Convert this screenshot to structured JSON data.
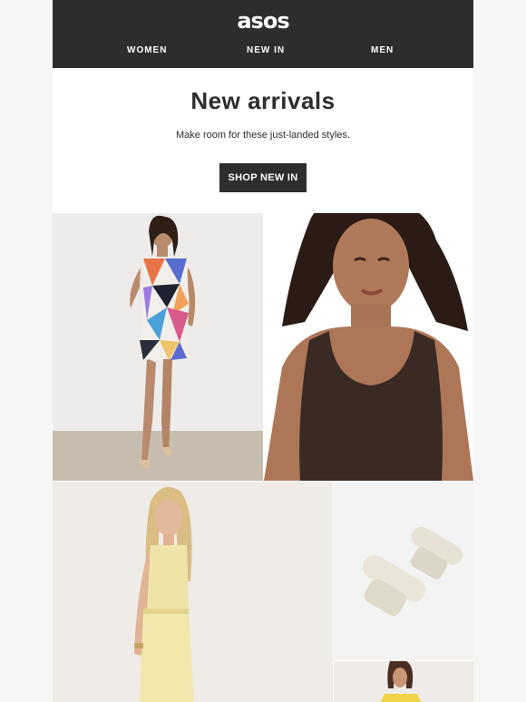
{
  "header": {
    "logo": "asos",
    "nav": [
      {
        "label": "WOMEN"
      },
      {
        "label": "NEW IN"
      },
      {
        "label": "MEN"
      }
    ]
  },
  "hero": {
    "title": "New arrivals",
    "subtitle": "Make room for these just-landed styles.",
    "cta_label": "SHOP NEW IN"
  },
  "products": [
    {
      "name": "woman in multicolour geometric print mini dress"
    },
    {
      "name": "woman in brown ribbed tank top"
    },
    {
      "name": "woman in pale yellow co-ord"
    },
    {
      "name": "cream leather slide sandals"
    },
    {
      "name": "woman in yellow top"
    }
  ],
  "colors": {
    "header_bg": "#2d2d2d",
    "text": "#2d2d2d",
    "cta_bg": "#2d2d2d",
    "page_bg": "#f6f6f6"
  }
}
